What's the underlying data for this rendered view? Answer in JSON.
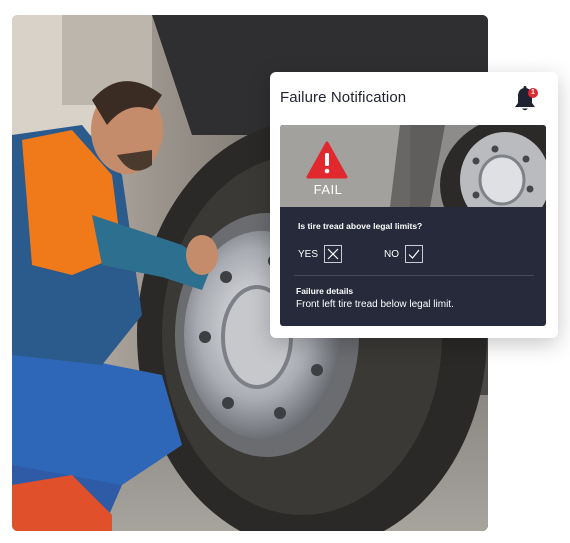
{
  "notification": {
    "title": "Failure Notification",
    "badge_count": "1",
    "status_label": "FAIL",
    "question": "Is tire tread above legal limits?",
    "options": [
      {
        "label": "YES",
        "checked": false
      },
      {
        "label": "NO",
        "checked": true
      }
    ],
    "details_title": "Failure details",
    "details_text": "Front left tire tread below legal limit."
  },
  "colors": {
    "alert_red": "#e0282e",
    "panel_dark": "#262a3a",
    "card_bg": "#ffffff",
    "vest_orange": "#f07a1a"
  },
  "icons": [
    "bell-icon",
    "warning-icon",
    "x-mark-icon",
    "check-icon"
  ]
}
